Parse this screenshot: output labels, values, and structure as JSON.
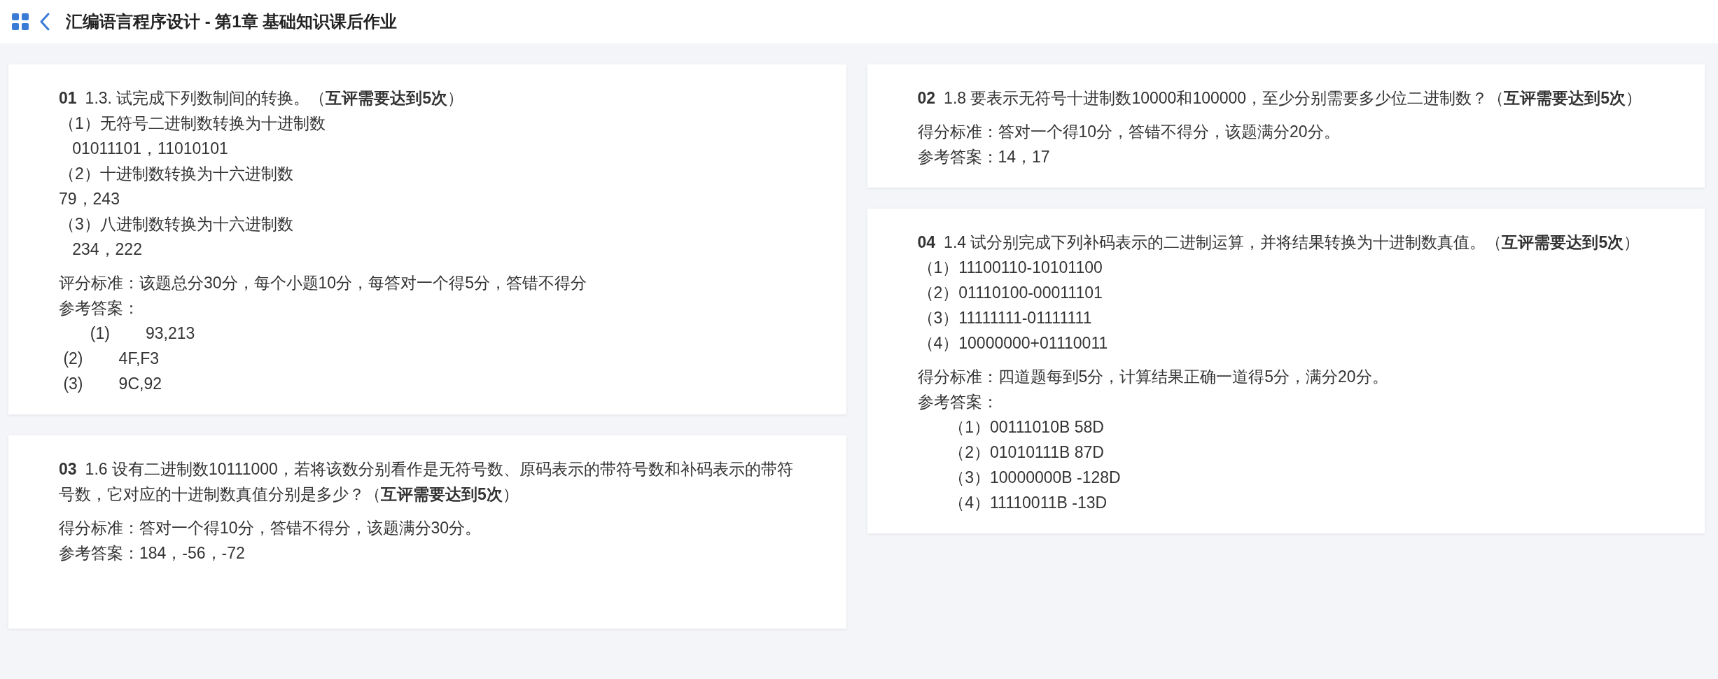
{
  "header": {
    "title": "汇编语言程序设计 - 第1章 基础知识课后作业"
  },
  "columns": [
    [
      {
        "number": "01",
        "title": "1.3. 试完成下列数制间的转换。（**互评需要达到5次**）",
        "lines": [
          "（1）无符号二进制数转换为十进制数",
          "   01011101，11010101",
          "（2）十进制数转换为十六进制数",
          "79，243",
          "（3）八进制数转换为十六进制数",
          "   234，222"
        ],
        "criteria": "评分标准：该题总分30分，每个小题10分，每答对一个得5分，答错不得分",
        "answer_label": "参考答案：",
        "answers": [
          "       (1)        93,213",
          " (2)        4F,F3",
          " (3)        9C,92"
        ]
      },
      {
        "number": "03",
        "title": "1.6 设有二进制数10111000，若将该数分别看作是无符号数、原码表示的带符号数和补码表示的带符号数，它对应的十进制数真值分别是多少？（**互评需要达到5次**）",
        "criteria": "得分标准：答对一个得10分，答错不得分，该题满分30分。",
        "answer_label": "参考答案：184，-56，-72"
      }
    ],
    [
      {
        "number": "02",
        "title": "1.8 要表示无符号十进制数10000和100000，至少分别需要多少位二进制数？（**互评需要达到5次**）",
        "criteria": "得分标准：答对一个得10分，答错不得分，该题满分20分。",
        "answer_label": "参考答案：14，17"
      },
      {
        "number": "04",
        "title": "1.4 试分别完成下列补码表示的二进制运算，并将结果转换为十进制数真值。（**互评需要达到5次**）",
        "lines": [
          "（1）11100110-10101100",
          "（2）01110100-00011101",
          "（3）11111111-01111111",
          "（4）10000000+01110011"
        ],
        "criteria": "得分标准：四道题每到5分，计算结果正确一道得5分，满分20分。",
        "answer_label": "参考答案：",
        "answers": [
          "       （1）00111010B 58D",
          "       （2）01010111B 87D",
          "       （3）10000000B -128D",
          "       （4）11110011B -13D"
        ]
      }
    ]
  ]
}
